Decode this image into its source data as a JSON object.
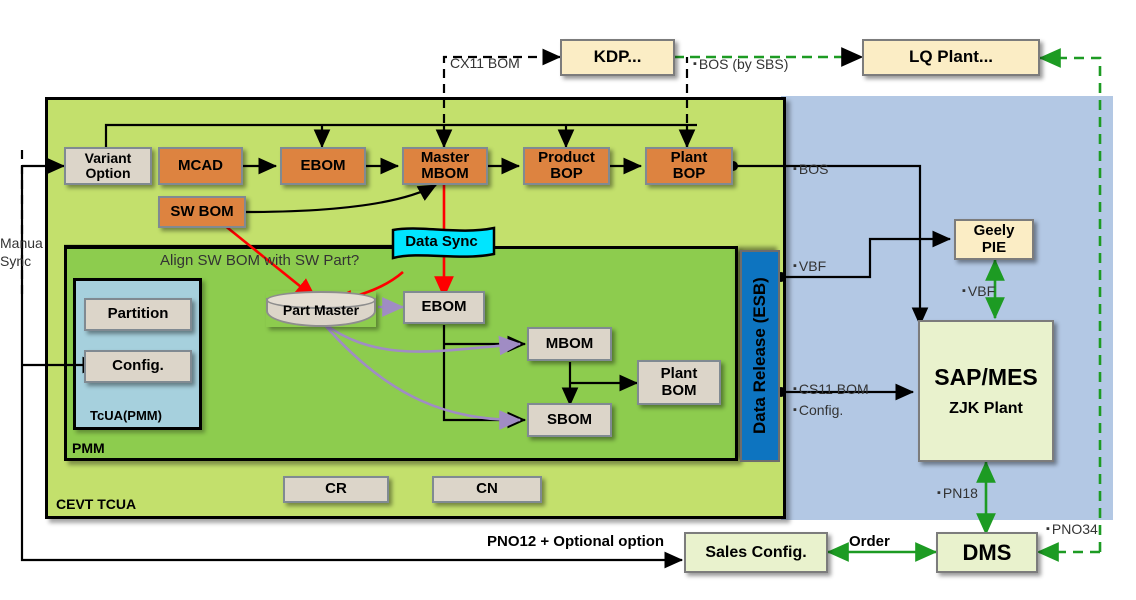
{
  "containers": {
    "cevt": "CEVT TCUA",
    "pmm": "PMM",
    "tcua": "TcUA(PMM)"
  },
  "top_boxes": {
    "kdp": "KDP...",
    "lq_plant": "LQ Plant..."
  },
  "tcua_row": [
    {
      "id": "variant-option",
      "label": "Variant\nOption"
    },
    {
      "id": "mcad",
      "label": "MCAD"
    },
    {
      "id": "ebom",
      "label": "EBOM"
    },
    {
      "id": "master-mbom",
      "label": "Master\nMBOM"
    },
    {
      "id": "product-bop",
      "label": "Product\nBOP"
    },
    {
      "id": "plant-bop",
      "label": "Plant\nBOP"
    }
  ],
  "sw_bom": "SW BOM",
  "tcua_inner": {
    "partition": "Partition",
    "config": "Config."
  },
  "pmm_boxes": {
    "part_master": "Part Master",
    "ebom": "EBOM",
    "mbom": "MBOM",
    "sbom": "SBOM",
    "plant_bom": "Plant\nBOM"
  },
  "cevt_bottom": {
    "cr": "CR",
    "cn": "CN"
  },
  "banner": "Data Sync",
  "esb": "Data Release (ESB)",
  "right_boxes": {
    "geely_pie": "Geely\nPIE",
    "sap_mes_title": "SAP/MES",
    "sap_mes_sub": "ZJK Plant",
    "dms": "DMS",
    "sales_config": "Sales Config."
  },
  "edge_labels": {
    "cx11_bom": "CX11 BOM",
    "bos_by_sbs": "BOS (by SBS)",
    "bos": "BOS",
    "vbf_esb": "VBF",
    "vbf_pie": "VBF",
    "cs11_bom": "CS11 BOM",
    "config": "Config.",
    "pn18": "PN18",
    "pno34": "PNO34",
    "manual_sync_1": "Manua",
    "manual_sync_2": "Sync",
    "align_sw": "Align SW BOM with SW Part?",
    "pno12": "PNO12 + Optional option",
    "order": "Order"
  },
  "colors": {
    "outer_green": "#c3e06c",
    "inner_green": "#8dcc4e",
    "tcua_blue": "#a6d0dd",
    "panel_blue": "#b3c8e4",
    "orange": "#dd8340",
    "grey_box": "#dcd5c9",
    "cream": "#fbedc5",
    "light_green_box": "#e9f2cd",
    "esb_blue": "#0d74c0",
    "cyan": "#00e5ff",
    "green_arrow": "#1d9b23",
    "red_arrow": "#ff0000",
    "purple_arrow": "#a08cc4"
  }
}
